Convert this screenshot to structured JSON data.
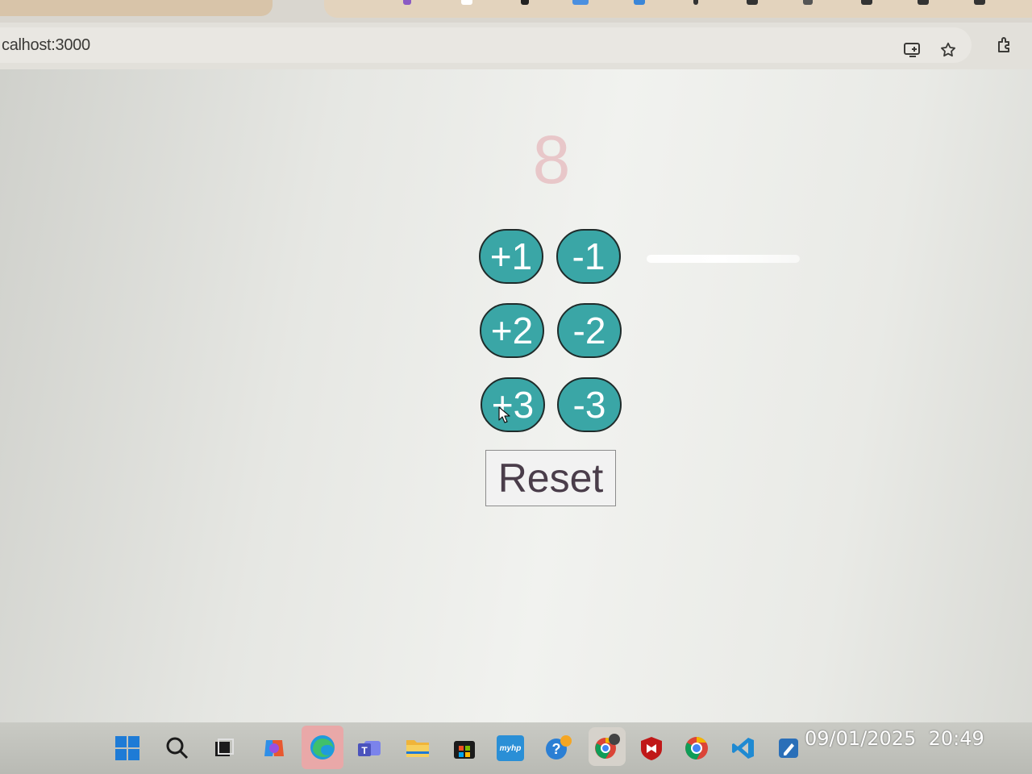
{
  "browser": {
    "url": "calhost:3000",
    "icons": [
      "install-app-icon",
      "bookmark-star-icon",
      "extensions-icon"
    ]
  },
  "app": {
    "counter_value": "8",
    "buttons": [
      {
        "label": "+1"
      },
      {
        "label": "-1"
      },
      {
        "label": "+2"
      },
      {
        "label": "-2"
      },
      {
        "label": "+3"
      },
      {
        "label": "-3"
      }
    ],
    "reset_label": "Reset",
    "colors": {
      "button_fill": "#3aa6a6",
      "button_border": "#1f2b2a",
      "counter_text": "#e8c7c9"
    }
  },
  "taskbar": {
    "apps": [
      "windows-start-icon",
      "search-icon",
      "task-view-icon",
      "copilot-icon",
      "edge-icon",
      "teams-icon",
      "file-explorer-icon",
      "store-icon",
      "myhp-icon",
      "help-icon",
      "chrome-profile-icon",
      "mcafee-icon",
      "chrome-icon",
      "vscode-icon",
      "app-icon"
    ],
    "myhp_text": "myhp",
    "date": "09/01/2025",
    "time": "20:49"
  }
}
